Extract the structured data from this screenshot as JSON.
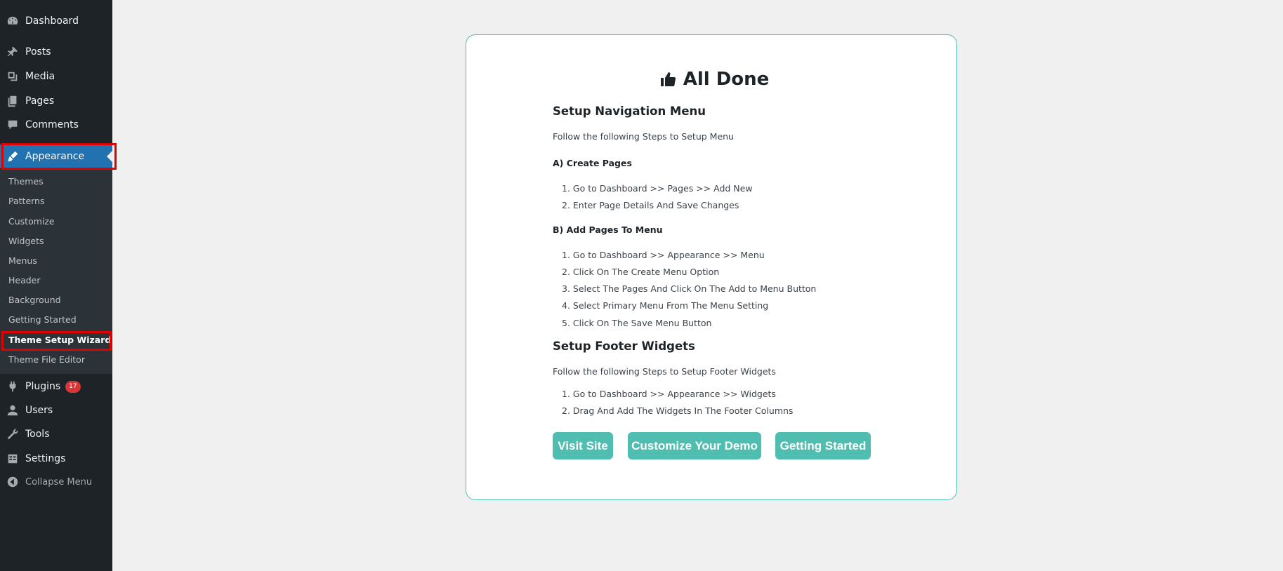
{
  "sidebar": {
    "items": [
      {
        "label": "Dashboard",
        "icon": "dashboard-icon"
      },
      {
        "label": "Posts",
        "icon": "pin-icon"
      },
      {
        "label": "Media",
        "icon": "media-icon"
      },
      {
        "label": "Pages",
        "icon": "pages-icon"
      },
      {
        "label": "Comments",
        "icon": "comment-icon"
      },
      {
        "label": "Appearance",
        "icon": "brush-icon"
      },
      {
        "label": "Plugins",
        "icon": "plug-icon",
        "badge": "17"
      },
      {
        "label": "Users",
        "icon": "user-icon"
      },
      {
        "label": "Tools",
        "icon": "wrench-icon"
      },
      {
        "label": "Settings",
        "icon": "settings-icon"
      }
    ],
    "submenu": [
      "Themes",
      "Patterns",
      "Customize",
      "Widgets",
      "Menus",
      "Header",
      "Background",
      "Getting Started",
      "Theme Setup Wizard",
      "Theme File Editor"
    ],
    "collapse_label": "Collapse Menu"
  },
  "wizard": {
    "title": "All Done",
    "nav_heading": "Setup Navigation Menu",
    "nav_intro": "Follow the following Steps to Setup Menu",
    "create_pages_heading": "A) Create Pages",
    "create_pages_steps": [
      "1. Go to Dashboard >> Pages >> Add New",
      "2. Enter Page Details And Save Changes"
    ],
    "add_pages_heading": "B) Add Pages To Menu",
    "add_pages_steps": [
      "1. Go to Dashboard >> Appearance >> Menu",
      "2. Click On The Create Menu Option",
      "3. Select The Pages And Click On The Add to Menu Button",
      "4. Select Primary Menu From The Menu Setting",
      "5. Click On The Save Menu Button"
    ],
    "footer_heading": "Setup Footer Widgets",
    "footer_intro": "Follow the following Steps to Setup Footer Widgets",
    "footer_steps": [
      "1. Go to Dashboard >> Appearance >> Widgets",
      "2. Drag And Add The Widgets In The Footer Columns"
    ],
    "buttons": {
      "visit_site": "Visit Site",
      "customize_demo": "Customize Your Demo",
      "getting_started": "Getting Started"
    }
  },
  "colors": {
    "sidebar_bg": "#1d2327",
    "active_bg": "#2271b1",
    "button_bg": "#4fbdb0",
    "highlight": "#e00000"
  }
}
